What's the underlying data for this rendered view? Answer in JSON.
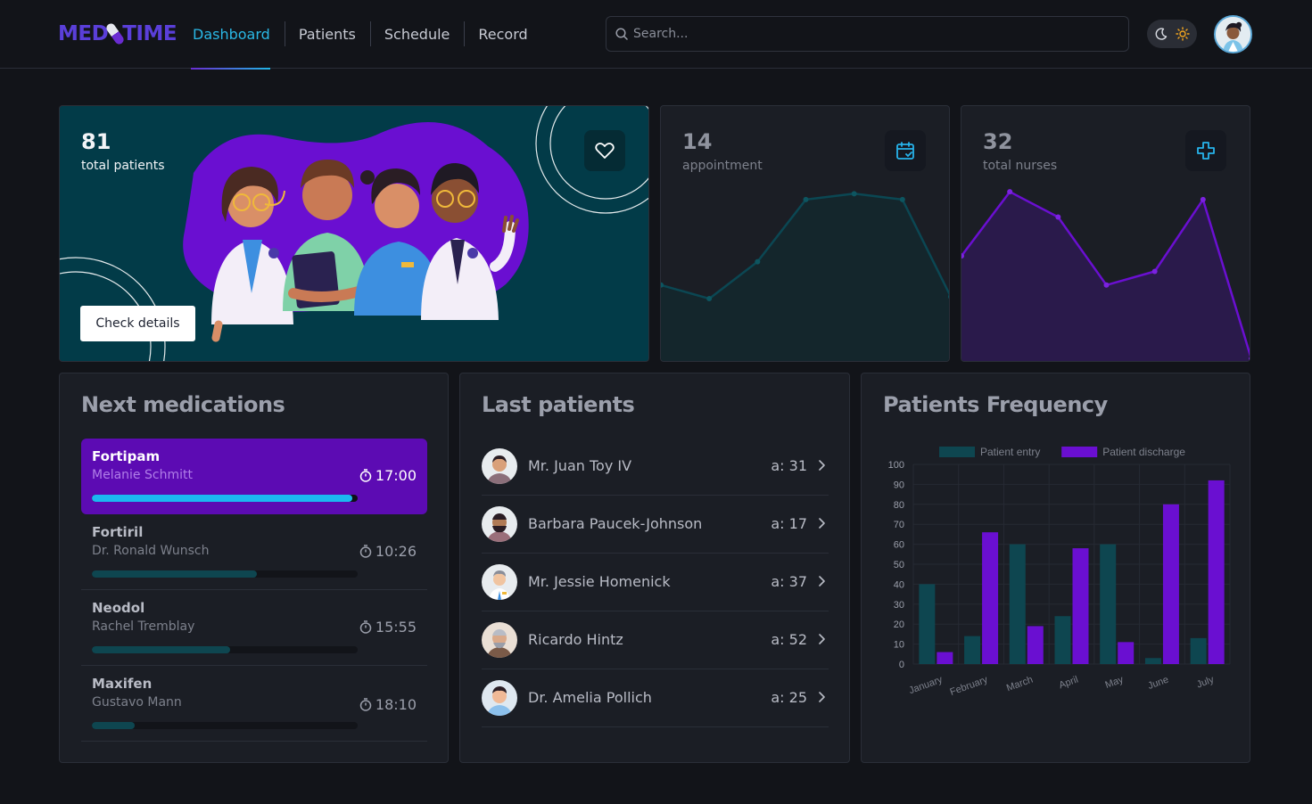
{
  "app": {
    "logo_left": "MED",
    "logo_right": "TIME"
  },
  "nav": {
    "items": [
      {
        "label": "Dashboard",
        "active": true
      },
      {
        "label": "Patients",
        "active": false
      },
      {
        "label": "Schedule",
        "active": false
      },
      {
        "label": "Record",
        "active": false
      }
    ]
  },
  "search": {
    "placeholder": "Search..."
  },
  "hero": {
    "count": "81",
    "label": "total patients",
    "button": "Check details"
  },
  "stats": [
    {
      "count": "14",
      "label": "appointment",
      "icon": "calendar-check-icon"
    },
    {
      "count": "32",
      "label": "total nurses",
      "icon": "plus-cross-icon"
    }
  ],
  "medications": {
    "title": "Next medications",
    "items": [
      {
        "name": "Fortipam",
        "doctor": "Melanie Schmitt",
        "time": "17:00",
        "progress": 0.98,
        "active": true
      },
      {
        "name": "Fortiril",
        "doctor": "Dr. Ronald Wunsch",
        "time": "10:26",
        "progress": 0.62,
        "active": false
      },
      {
        "name": "Neodol",
        "doctor": "Rachel Tremblay",
        "time": "15:55",
        "progress": 0.52,
        "active": false
      },
      {
        "name": "Maxifen",
        "doctor": "Gustavo Mann",
        "time": "18:10",
        "progress": 0.16,
        "active": false
      }
    ]
  },
  "patients": {
    "title": "Last patients",
    "items": [
      {
        "name": "Mr. Juan Toy IV",
        "age": "a: 31"
      },
      {
        "name": "Barbara Paucek-Johnson",
        "age": "a: 17"
      },
      {
        "name": "Mr. Jessie Homenick",
        "age": "a: 37"
      },
      {
        "name": "Ricardo Hintz",
        "age": "a: 52"
      },
      {
        "name": "Dr. Amelia Pollich",
        "age": "a: 25"
      }
    ]
  },
  "colors": {
    "accent_blue": "#2ab8e6",
    "accent_purple": "#6a0fd1",
    "teal_dark": "#0e4650"
  },
  "chart_data": [
    {
      "type": "bar",
      "title": "Patients Frequency",
      "categories": [
        "January",
        "February",
        "March",
        "April",
        "May",
        "June",
        "July"
      ],
      "series": [
        {
          "name": "Patient entry",
          "color": "#0e4650",
          "values": [
            40,
            14,
            60,
            24,
            60,
            3,
            13
          ]
        },
        {
          "name": "Patient discharge",
          "color": "#6a0fd1",
          "values": [
            6,
            66,
            19,
            58,
            11,
            80,
            92
          ]
        }
      ],
      "ylim": [
        0,
        100
      ],
      "yticks": [
        0,
        10,
        20,
        30,
        40,
        50,
        60,
        70,
        80,
        90,
        100
      ],
      "legend": "top",
      "grid": true
    },
    {
      "type": "area",
      "values": [
        40,
        33,
        52,
        84,
        87,
        84,
        34
      ]
    },
    {
      "type": "area",
      "values": [
        55,
        88,
        75,
        40,
        47,
        84,
        2
      ]
    }
  ]
}
